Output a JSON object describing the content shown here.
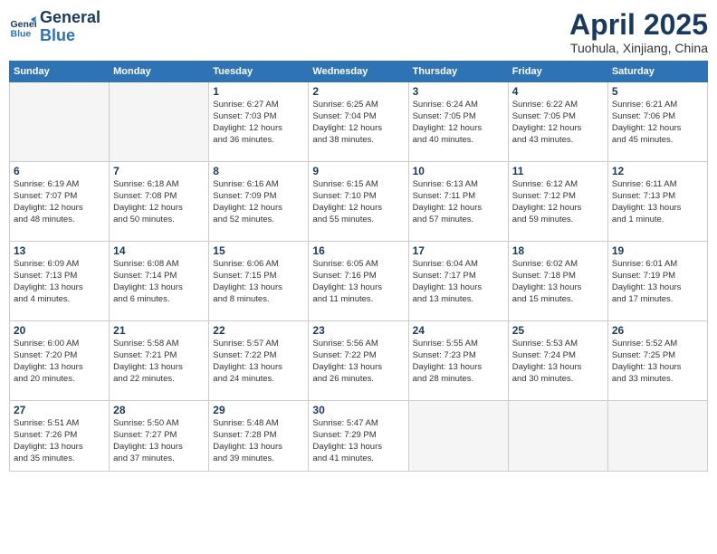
{
  "header": {
    "logo_line1": "General",
    "logo_line2": "Blue",
    "month_title": "April 2025",
    "location": "Tuohula, Xinjiang, China"
  },
  "weekdays": [
    "Sunday",
    "Monday",
    "Tuesday",
    "Wednesday",
    "Thursday",
    "Friday",
    "Saturday"
  ],
  "weeks": [
    [
      {
        "day": "",
        "info": ""
      },
      {
        "day": "",
        "info": ""
      },
      {
        "day": "1",
        "info": "Sunrise: 6:27 AM\nSunset: 7:03 PM\nDaylight: 12 hours\nand 36 minutes."
      },
      {
        "day": "2",
        "info": "Sunrise: 6:25 AM\nSunset: 7:04 PM\nDaylight: 12 hours\nand 38 minutes."
      },
      {
        "day": "3",
        "info": "Sunrise: 6:24 AM\nSunset: 7:05 PM\nDaylight: 12 hours\nand 40 minutes."
      },
      {
        "day": "4",
        "info": "Sunrise: 6:22 AM\nSunset: 7:05 PM\nDaylight: 12 hours\nand 43 minutes."
      },
      {
        "day": "5",
        "info": "Sunrise: 6:21 AM\nSunset: 7:06 PM\nDaylight: 12 hours\nand 45 minutes."
      }
    ],
    [
      {
        "day": "6",
        "info": "Sunrise: 6:19 AM\nSunset: 7:07 PM\nDaylight: 12 hours\nand 48 minutes."
      },
      {
        "day": "7",
        "info": "Sunrise: 6:18 AM\nSunset: 7:08 PM\nDaylight: 12 hours\nand 50 minutes."
      },
      {
        "day": "8",
        "info": "Sunrise: 6:16 AM\nSunset: 7:09 PM\nDaylight: 12 hours\nand 52 minutes."
      },
      {
        "day": "9",
        "info": "Sunrise: 6:15 AM\nSunset: 7:10 PM\nDaylight: 12 hours\nand 55 minutes."
      },
      {
        "day": "10",
        "info": "Sunrise: 6:13 AM\nSunset: 7:11 PM\nDaylight: 12 hours\nand 57 minutes."
      },
      {
        "day": "11",
        "info": "Sunrise: 6:12 AM\nSunset: 7:12 PM\nDaylight: 12 hours\nand 59 minutes."
      },
      {
        "day": "12",
        "info": "Sunrise: 6:11 AM\nSunset: 7:13 PM\nDaylight: 13 hours\nand 1 minute."
      }
    ],
    [
      {
        "day": "13",
        "info": "Sunrise: 6:09 AM\nSunset: 7:13 PM\nDaylight: 13 hours\nand 4 minutes."
      },
      {
        "day": "14",
        "info": "Sunrise: 6:08 AM\nSunset: 7:14 PM\nDaylight: 13 hours\nand 6 minutes."
      },
      {
        "day": "15",
        "info": "Sunrise: 6:06 AM\nSunset: 7:15 PM\nDaylight: 13 hours\nand 8 minutes."
      },
      {
        "day": "16",
        "info": "Sunrise: 6:05 AM\nSunset: 7:16 PM\nDaylight: 13 hours\nand 11 minutes."
      },
      {
        "day": "17",
        "info": "Sunrise: 6:04 AM\nSunset: 7:17 PM\nDaylight: 13 hours\nand 13 minutes."
      },
      {
        "day": "18",
        "info": "Sunrise: 6:02 AM\nSunset: 7:18 PM\nDaylight: 13 hours\nand 15 minutes."
      },
      {
        "day": "19",
        "info": "Sunrise: 6:01 AM\nSunset: 7:19 PM\nDaylight: 13 hours\nand 17 minutes."
      }
    ],
    [
      {
        "day": "20",
        "info": "Sunrise: 6:00 AM\nSunset: 7:20 PM\nDaylight: 13 hours\nand 20 minutes."
      },
      {
        "day": "21",
        "info": "Sunrise: 5:58 AM\nSunset: 7:21 PM\nDaylight: 13 hours\nand 22 minutes."
      },
      {
        "day": "22",
        "info": "Sunrise: 5:57 AM\nSunset: 7:22 PM\nDaylight: 13 hours\nand 24 minutes."
      },
      {
        "day": "23",
        "info": "Sunrise: 5:56 AM\nSunset: 7:22 PM\nDaylight: 13 hours\nand 26 minutes."
      },
      {
        "day": "24",
        "info": "Sunrise: 5:55 AM\nSunset: 7:23 PM\nDaylight: 13 hours\nand 28 minutes."
      },
      {
        "day": "25",
        "info": "Sunrise: 5:53 AM\nSunset: 7:24 PM\nDaylight: 13 hours\nand 30 minutes."
      },
      {
        "day": "26",
        "info": "Sunrise: 5:52 AM\nSunset: 7:25 PM\nDaylight: 13 hours\nand 33 minutes."
      }
    ],
    [
      {
        "day": "27",
        "info": "Sunrise: 5:51 AM\nSunset: 7:26 PM\nDaylight: 13 hours\nand 35 minutes."
      },
      {
        "day": "28",
        "info": "Sunrise: 5:50 AM\nSunset: 7:27 PM\nDaylight: 13 hours\nand 37 minutes."
      },
      {
        "day": "29",
        "info": "Sunrise: 5:48 AM\nSunset: 7:28 PM\nDaylight: 13 hours\nand 39 minutes."
      },
      {
        "day": "30",
        "info": "Sunrise: 5:47 AM\nSunset: 7:29 PM\nDaylight: 13 hours\nand 41 minutes."
      },
      {
        "day": "",
        "info": ""
      },
      {
        "day": "",
        "info": ""
      },
      {
        "day": "",
        "info": ""
      }
    ]
  ]
}
